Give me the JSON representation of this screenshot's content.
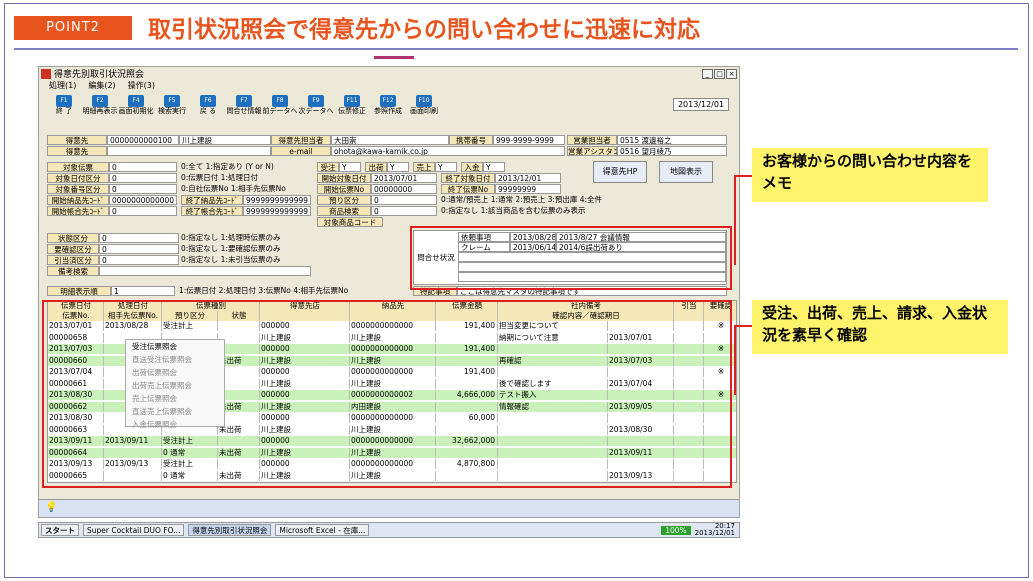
{
  "slide": {
    "point_label": "POINT2",
    "headline": "取引状況照会で得意先からの問い合わせに迅速に対応",
    "callout1": "お客様からの問い合わせ内容をメモ",
    "callout2": "受注、出荷、売上、請求、入金状況を素早く確認"
  },
  "window": {
    "title": "得意先別取引状況照会",
    "menu": [
      "処理(1)",
      "編集(2)",
      "操作(3)"
    ],
    "date": "2013/12/01"
  },
  "toolbar": [
    {
      "key": "F1",
      "label": "終 了"
    },
    {
      "key": "F2",
      "label": "明細再表示"
    },
    {
      "key": "F4",
      "label": "画面初期化"
    },
    {
      "key": "F5",
      "label": "検索実行"
    },
    {
      "key": "F6",
      "label": "戻 る"
    },
    {
      "key": "F7",
      "label": "問合せ情報"
    },
    {
      "key": "F8",
      "label": "前データへ"
    },
    {
      "key": "F9",
      "label": "次データへ"
    },
    {
      "key": "F11",
      "label": "伝票修正"
    },
    {
      "key": "F12",
      "label": "参照作成"
    },
    {
      "key": "F10",
      "label": "画面印刷"
    }
  ],
  "form": {
    "tokuisaki_l": "得意先",
    "tokuisaki_code": "0000000000100",
    "tokuisaki_name": "川上建設",
    "tantou_l": "得意先担当者",
    "tantou_v": "大田崇",
    "tel_l": "携帯番号",
    "tel_v": "999-9999-9999",
    "eig_l": "営業担当者",
    "eig_v": "0515 渡邊裕之",
    "tokuisakikou_l": "得意先",
    "email_l": "e-mail",
    "email_v": "ohota@kawa-kamik.co.jp",
    "asst_l": "営業アシスタント",
    "asst_v": "0516 望月綾乃",
    "tk_l": "対象伝票",
    "tk_v": "0",
    "tk_h": "0:全て 1:指定あり (Y or N)",
    "hk_l": "対象日付区分",
    "hk_v": "0",
    "hk_h": "0:伝票日付 1:処理日付",
    "bk_l": "対象番号区分",
    "bk_v": "0",
    "bk_h": "0:自社伝票No 1:相手先伝票No",
    "sn_l": "開始納品先ｺｰﾄﾞ",
    "sn_v": "0000000000000",
    "en_l": "終了納品先ｺｰﾄﾞ",
    "en_v": "9999999999999",
    "sc_l": "開始帳合先ｺｰﾄﾞ",
    "sc_v": "0",
    "ec_l": "終了帳合先ｺｰﾄﾞ",
    "ec_v": "9999999999999",
    "chk": [
      {
        "l": "受注",
        "v": "Y"
      },
      {
        "l": "出荷",
        "v": "Y"
      },
      {
        "l": "売上",
        "v": "Y"
      },
      {
        "l": "入金",
        "v": "Y"
      }
    ],
    "sd_l": "開始対象日付",
    "sd_v": "2013/07/01",
    "ed_l": "終了対象日付",
    "ed_v": "2013/12/01",
    "sno_l": "開始伝票No",
    "sno_v": "00000000",
    "eno_l": "終了伝票No",
    "eno_v": "99999999",
    "az_l": "預り区分",
    "az_v": "0",
    "az_h": "0:通常/預売上 1:通常 2:預売上 3:預出庫 4:全件",
    "sk_l": "商品検索",
    "sk_v": "0",
    "sk_h": "0:指定なし 1:該当商品を含む伝票のみ表示",
    "tsc_l": "対象商品コード",
    "btn_hp": "得意先HP",
    "btn_map": "地図表示",
    "jo_l": "状態区分",
    "jo_v": "0",
    "jo_h": "0:指定なし 1:処理時伝票のみ",
    "yk_l": "要確認区分",
    "yk_v": "0",
    "yk_h": "0:指定なし 1:要確認伝票のみ",
    "ht_l": "引当済区分",
    "ht_v": "0",
    "ht_h": "0:指定なし 1:未引当伝票のみ",
    "bik_l": "備考検索",
    "ms_l": "明細表示順",
    "ms_v": "1",
    "ms_h": "1:伝票日付 2:処理日付 3:伝票No 4:相手先伝票No",
    "tk2_l": "特記事項",
    "tk2_v": "ここは得意先マスタの特記事項です",
    "inq_l": "問合せ状況",
    "inq": [
      {
        "a": "依頼事項",
        "b": "2013/08/28",
        "c": "2013/8/27 会議情報"
      },
      {
        "a": "クレーム",
        "b": "2013/06/14",
        "c": "2014/6誤出荷あり"
      }
    ]
  },
  "table": {
    "h1": [
      "伝票日付",
      "処理日付",
      "伝票種別",
      "得意先店",
      "納品先",
      "伝票金額",
      "社内備考",
      "引当",
      "要確認"
    ],
    "h2": [
      "伝票No.",
      "相手先伝票No.",
      "預り区分",
      "状態",
      "確認内容／確認期日"
    ],
    "rows": [
      {
        "a": "2013/07/01",
        "b": "2013/08/28",
        "c": "受注計上",
        "d": "",
        "e": "000000",
        "f": "0000000000000",
        "g": "191,400",
        "h": "担当変更について",
        "i": "",
        "j": "",
        "k": "※",
        "cls": "w"
      },
      {
        "a": "00000658",
        "b": "",
        "c": "",
        "d": "",
        "e": "川上建設",
        "f": "川上建設",
        "g": "",
        "h": "納期について注意",
        "i": "2013/07/01",
        "j": "",
        "k": "",
        "cls": "w"
      },
      {
        "a": "2013/07/03",
        "b": "",
        "c": "",
        "d": "",
        "e": "000000",
        "f": "0000000000000",
        "g": "191,400",
        "h": "",
        "i": "",
        "j": "",
        "k": "※",
        "cls": "g"
      },
      {
        "a": "00000660",
        "b": "",
        "c": "",
        "d": "未出荷",
        "e": "川上建設",
        "f": "川上建設",
        "g": "",
        "h": "再確認",
        "i": "2013/07/03",
        "j": "",
        "k": "",
        "cls": "g"
      },
      {
        "a": "2013/07/04",
        "b": "",
        "c": "",
        "d": "",
        "e": "000000",
        "f": "0000000000000",
        "g": "191,400",
        "h": "",
        "i": "",
        "j": "",
        "k": "※",
        "cls": "w"
      },
      {
        "a": "00000661",
        "b": "",
        "c": "",
        "d": "",
        "e": "川上建設",
        "f": "川上建設",
        "g": "",
        "h": "後で確認します",
        "i": "2013/07/04",
        "j": "",
        "k": "",
        "cls": "w"
      },
      {
        "a": "2013/08/30",
        "b": "",
        "c": "",
        "d": "",
        "e": "000000",
        "f": "0000000000002",
        "g": "4,666,000",
        "h": "テスト搬入",
        "i": "",
        "j": "",
        "k": "※",
        "cls": "g"
      },
      {
        "a": "00000662",
        "b": "",
        "c": "",
        "d": "未出荷",
        "e": "川上建設",
        "f": "内田建設",
        "g": "",
        "h": "情報確認",
        "i": "2013/09/05",
        "j": "",
        "k": "",
        "cls": "g"
      },
      {
        "a": "2013/08/30",
        "b": "",
        "c": "",
        "d": "",
        "e": "000000",
        "f": "0000000000000",
        "g": "60,000",
        "h": "",
        "i": "",
        "j": "",
        "k": "",
        "cls": "w"
      },
      {
        "a": "00000663",
        "b": "",
        "c": "",
        "d": "未出荷",
        "e": "川上建設",
        "f": "川上建設",
        "g": "",
        "h": "",
        "i": "2013/08/30",
        "j": "",
        "k": "",
        "cls": "w"
      },
      {
        "a": "2013/09/11",
        "b": "2013/09/11",
        "c": "受注計上",
        "d": "",
        "e": "000000",
        "f": "0000000000000",
        "g": "32,662,000",
        "h": "",
        "i": "",
        "j": "",
        "k": "",
        "cls": "g"
      },
      {
        "a": "00000664",
        "b": "",
        "c": "0 通常",
        "d": "未出荷",
        "e": "川上建設",
        "f": "川上建設",
        "g": "",
        "h": "",
        "i": "2013/09/11",
        "j": "",
        "k": "",
        "cls": "g"
      },
      {
        "a": "2013/09/13",
        "b": "2013/09/13",
        "c": "受注計上",
        "d": "",
        "e": "000000",
        "f": "0000000000000",
        "g": "4,870,800",
        "h": "",
        "i": "",
        "j": "",
        "k": "",
        "cls": "w"
      },
      {
        "a": "00000665",
        "b": "",
        "c": "0 通常",
        "d": "未出荷",
        "e": "川上建設",
        "f": "川上建設",
        "g": "",
        "h": "",
        "i": "2013/09/13",
        "j": "",
        "k": "",
        "cls": "w"
      }
    ]
  },
  "context_menu": [
    "受注伝票照会",
    "直送受注伝票照会",
    "出荷伝票照会",
    "出荷売上伝票照会",
    "売上伝票照会",
    "直送売上伝票照会",
    "入金伝票照会"
  ],
  "taskbar": {
    "start": "スタート",
    "tasks": [
      "Super Cocktail DUO FO...",
      "得意先別取引状況照会",
      "Microsoft Excel - 在庫..."
    ],
    "ime": "100%",
    "time": "20:17",
    "date": "2013/12/01"
  }
}
